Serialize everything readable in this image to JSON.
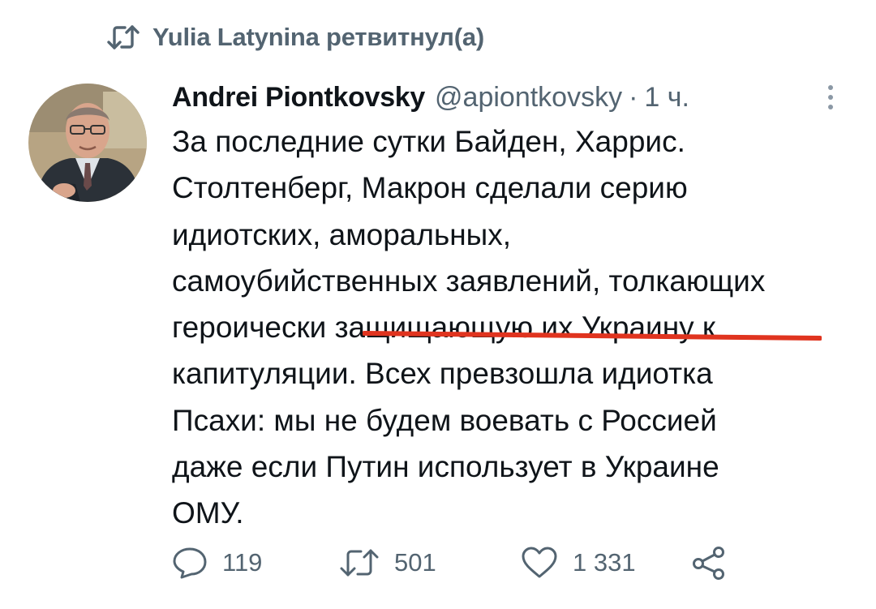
{
  "retweet_banner": {
    "text": "Yulia Latynina ретвитнул(а)",
    "icon": "retweet-icon"
  },
  "tweet": {
    "author": {
      "name": "Andrei Piontkovsky",
      "handle": "@apiontkovsky",
      "separator": "·",
      "time": "1 ч."
    },
    "text_lines": [
      "За последние сутки Байден, Харрис.",
      "Столтенберг, Макрон сделали серию",
      "идиотских, аморальных,",
      "самоубийственных заявлений, толкающих",
      "героически ",
      "защищающую их Украину к",
      "капитуляции. Всех превзошла идиотка",
      "Псахи: мы не будем воевать с Россией",
      "даже если Путин использует  в Украине",
      "ОМУ."
    ],
    "highlight_color": "#e0341f",
    "actions": {
      "replies": "119",
      "retweets": "501",
      "likes": "1 331"
    }
  },
  "colors": {
    "text": "#0f1419",
    "secondary": "#536471",
    "background": "#ffffff"
  }
}
